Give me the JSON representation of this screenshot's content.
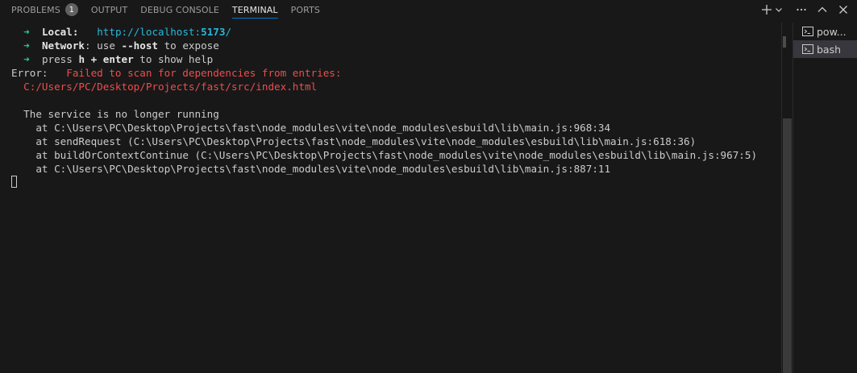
{
  "tabs": [
    {
      "label": "PROBLEMS",
      "badge": "1"
    },
    {
      "label": "OUTPUT"
    },
    {
      "label": "DEBUG CONSOLE"
    },
    {
      "label": "TERMINAL",
      "active": true
    },
    {
      "label": "PORTS"
    }
  ],
  "actions": {
    "new_terminal_icon": "plus-icon",
    "launch_profile_icon": "chevron-down-icon",
    "more_icon": "ellipsis-icon",
    "maximize_icon": "chevron-up-icon",
    "close_icon": "close-icon"
  },
  "terminal": {
    "local": {
      "arrow": "➜",
      "label": "Local",
      "colon": ":",
      "url_prefix": "http://localhost:",
      "port": "5173",
      "url_suffix": "/"
    },
    "network": {
      "arrow": "➜",
      "label": "Network",
      "text_before": ": use ",
      "flag": "--host",
      "text_after": " to expose"
    },
    "help": {
      "arrow": "➜",
      "text_before": "press ",
      "key": "h + enter",
      "text_after": " to show help"
    },
    "error_label": "Error:",
    "error_message": "Failed to scan for dependencies from entries:",
    "error_path": "C:/Users/PC/Desktop/Projects/fast/src/index.html",
    "service_message": "The service is no longer running",
    "stack": [
      "at C:\\Users\\PC\\Desktop\\Projects\\fast\\node_modules\\vite\\node_modules\\esbuild\\lib\\main.js:968:34",
      "at sendRequest (C:\\Users\\PC\\Desktop\\Projects\\fast\\node_modules\\vite\\node_modules\\esbuild\\lib\\main.js:618:36)",
      "at buildOrContextContinue (C:\\Users\\PC\\Desktop\\Projects\\fast\\node_modules\\vite\\node_modules\\esbuild\\lib\\main.js:967:5)",
      "at C:\\Users\\PC\\Desktop\\Projects\\fast\\node_modules\\vite\\node_modules\\esbuild\\lib\\main.js:887:11"
    ]
  },
  "terminal_list": [
    {
      "label": "pow...",
      "icon": "terminal-icon"
    },
    {
      "label": "bash",
      "icon": "terminal-icon",
      "selected": true
    }
  ],
  "colors": {
    "background": "#181818",
    "accent": "#0078d4",
    "green": "#23d18b",
    "cyan": "#29b8db",
    "red": "#f14c4c"
  }
}
